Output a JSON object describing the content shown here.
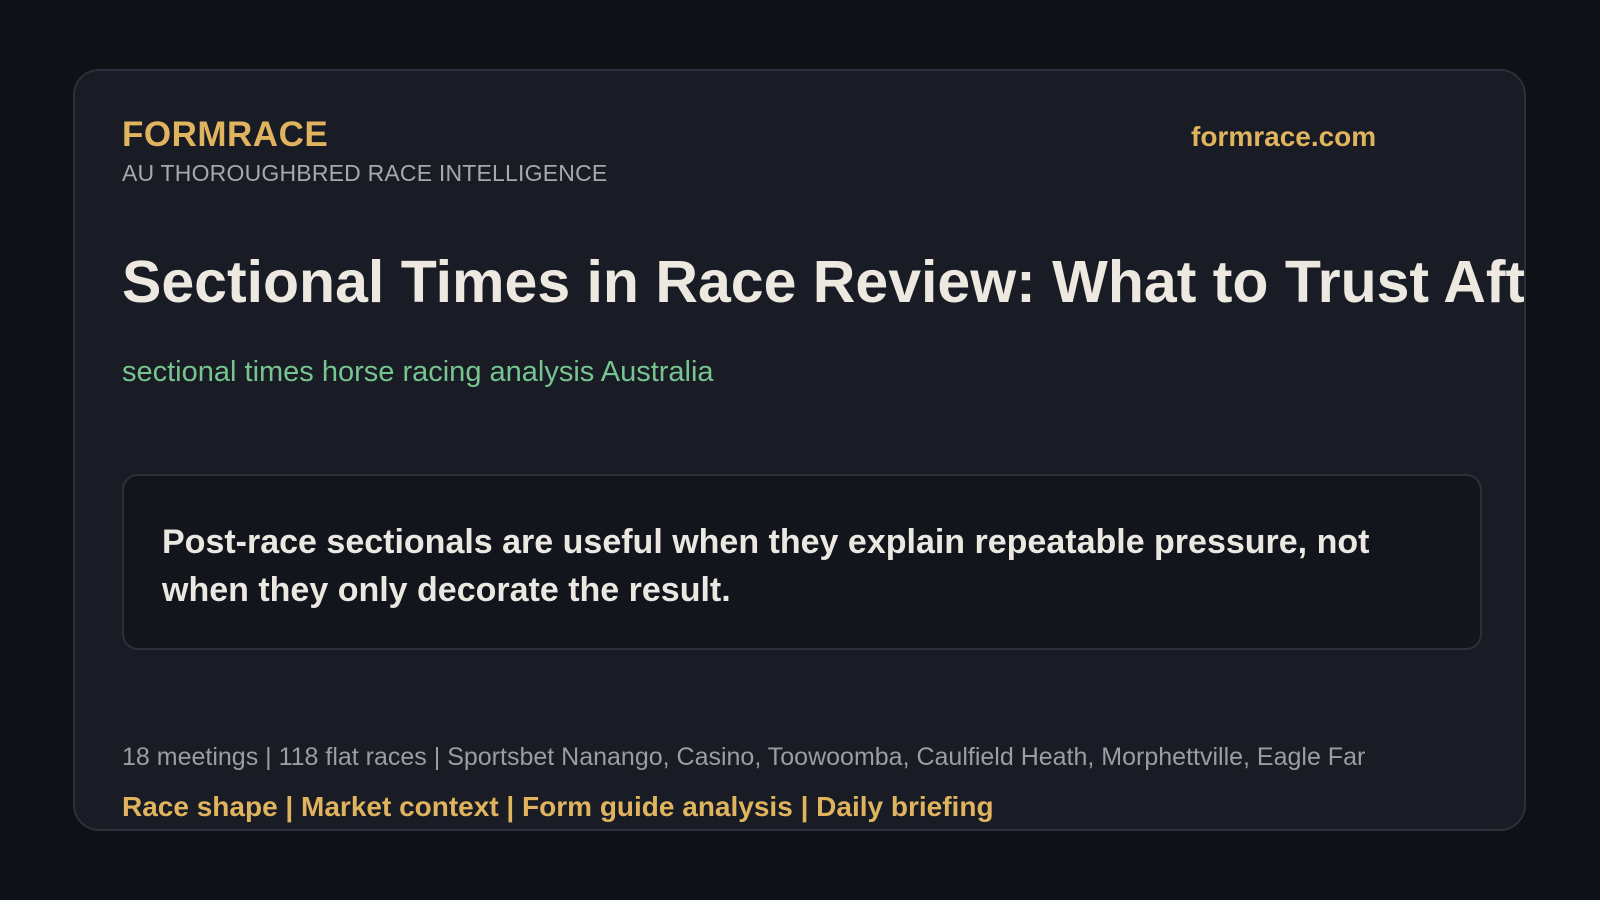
{
  "header": {
    "brand": "FORMRACE",
    "tagline": "AU THOROUGHBRED RACE INTELLIGENCE",
    "site": "formrace.com"
  },
  "article": {
    "headline": "Sectional Times in Race Review: What to Trust After the Run",
    "keywords": "sectional times horse racing analysis Australia",
    "quote": "Post-race sectionals are useful when they explain repeatable pressure, not when they only decorate the result."
  },
  "footer": {
    "meta": "18 meetings | 118 flat races | Sportsbet Nanango, Casino, Toowoomba, Caulfield Heath, Morphettville, Eagle Far",
    "topics": "Race shape | Market context | Form guide analysis | Daily briefing"
  },
  "colors": {
    "background": "#0e1116",
    "card": "#191c24",
    "accent": "#e0b45f",
    "keyword_green": "#76c48f",
    "headline": "#ede9e1"
  }
}
